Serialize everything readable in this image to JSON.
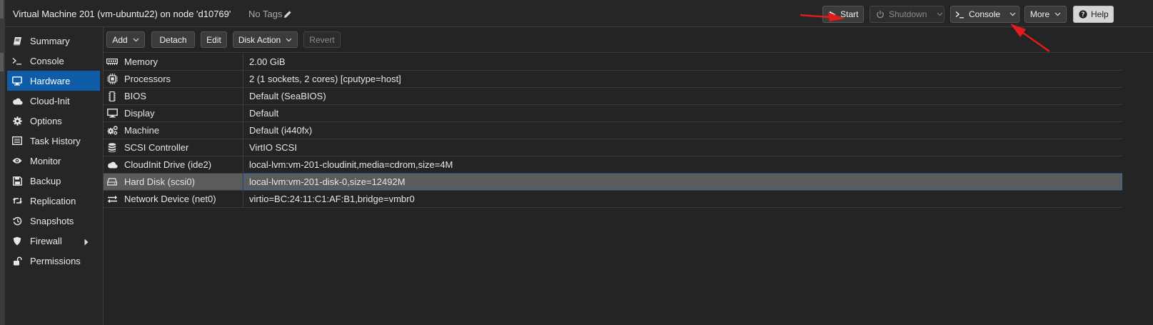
{
  "window": {
    "title": "Virtual Machine 201 (vm-ubuntu22) on node 'd10769'",
    "tags": "No Tags"
  },
  "top_buttons": {
    "start": "Start",
    "shutdown": "Shutdown",
    "console": "Console",
    "more": "More",
    "help": "Help"
  },
  "sidebar": {
    "items": [
      {
        "label": "Summary",
        "icon": "book-icon"
      },
      {
        "label": "Console",
        "icon": "terminal-icon"
      },
      {
        "label": "Hardware",
        "icon": "monitor-icon",
        "active": true
      },
      {
        "label": "Cloud-Init",
        "icon": "cloud-icon"
      },
      {
        "label": "Options",
        "icon": "gear-icon"
      },
      {
        "label": "Task History",
        "icon": "list-icon"
      },
      {
        "label": "Monitor",
        "icon": "eye-icon"
      },
      {
        "label": "Backup",
        "icon": "save-icon"
      },
      {
        "label": "Replication",
        "icon": "retweet-icon"
      },
      {
        "label": "Snapshots",
        "icon": "history-icon"
      },
      {
        "label": "Firewall",
        "icon": "shield-icon"
      },
      {
        "label": "Permissions",
        "icon": "unlock-icon"
      }
    ]
  },
  "toolbar": {
    "add": "Add",
    "detach": "Detach",
    "edit": "Edit",
    "disk_action": "Disk Action",
    "revert": "Revert"
  },
  "hardware": {
    "rows": [
      {
        "name": "Memory",
        "value": "2.00 GiB",
        "icon": "memory-icon"
      },
      {
        "name": "Processors",
        "value": "2 (1 sockets, 2 cores) [cputype=host]",
        "icon": "cpu-icon"
      },
      {
        "name": "BIOS",
        "value": "Default (SeaBIOS)",
        "icon": "microchip-icon"
      },
      {
        "name": "Display",
        "value": "Default",
        "icon": "desktop-icon"
      },
      {
        "name": "Machine",
        "value": "Default (i440fx)",
        "icon": "cogs-icon"
      },
      {
        "name": "SCSI Controller",
        "value": "VirtIO SCSI",
        "icon": "database-icon"
      },
      {
        "name": "CloudInit Drive (ide2)",
        "value": "local-lvm:vm-201-cloudinit,media=cdrom,size=4M",
        "icon": "cloud-icon"
      },
      {
        "name": "Hard Disk (scsi0)",
        "value": "local-lvm:vm-201-disk-0,size=12492M",
        "icon": "hdd-icon",
        "selected": true
      },
      {
        "name": "Network Device (net0)",
        "value": "virtio=BC:24:11:C1:AF:B1,bridge=vmbr0",
        "icon": "exchange-icon"
      }
    ]
  },
  "colors": {
    "accent": "#0f5da8",
    "annotation": "#e31b1b"
  }
}
